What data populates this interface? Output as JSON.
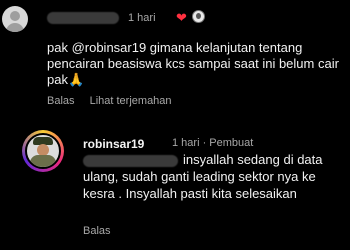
{
  "comment1": {
    "time": "1 hari",
    "heart_icon": "heart-filled-icon",
    "text": "pak @robinsar19 gimana kelanjutan tentang pencairan beasiswa kcs sampai saat ini belum cair pak🙏",
    "reply_label": "Balas",
    "translate_label": "Lihat terjemahan"
  },
  "comment2": {
    "username": "robinsar19",
    "meta": "1 hari · Pembuat",
    "text": "insyallah sedang di data ulang, sudah ganti leading sektor nya  ke kesra . Insyallah pasti kita selesaikan",
    "reply_label": "Balas"
  },
  "colors": {
    "like": "#ff3040",
    "secondary_text": "#a8a8a8",
    "background": "#000000"
  }
}
